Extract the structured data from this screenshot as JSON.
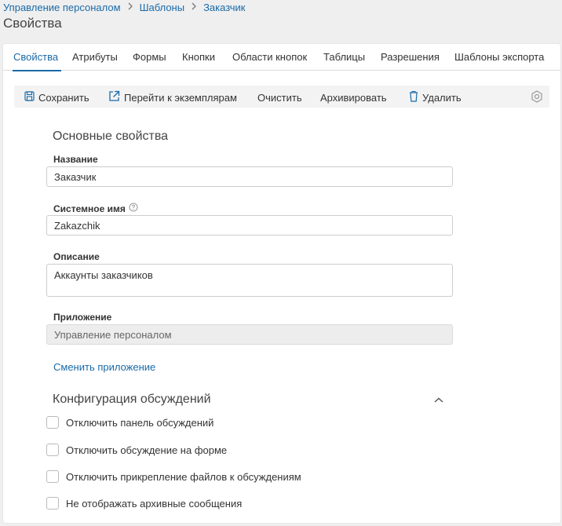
{
  "breadcrumb": {
    "items": [
      "Управление персоналом",
      "Шаблоны",
      "Заказчик"
    ]
  },
  "page": {
    "title": "Свойства"
  },
  "tabs": [
    {
      "label": "Свойства",
      "active": true
    },
    {
      "label": "Атрибуты"
    },
    {
      "label": "Формы"
    },
    {
      "label": "Кнопки"
    },
    {
      "label": "Области кнопок"
    },
    {
      "label": "Таблицы"
    },
    {
      "label": "Разрешения"
    },
    {
      "label": "Шаблоны экспорта"
    }
  ],
  "toolbar": {
    "save": "Сохранить",
    "goto_instances": "Перейти к экземплярам",
    "clear": "Очистить",
    "archive": "Архивировать",
    "delete": "Удалить",
    "settings_icon": "settings-icon"
  },
  "main_props": {
    "title": "Основные свойства",
    "name_label": "Название",
    "name_value": "Заказчик",
    "system_name_label": "Системное имя",
    "system_name_value": "Zakazchik",
    "description_label": "Описание",
    "description_value": "Аккаунты заказчиков",
    "application_label": "Приложение",
    "application_value": "Управление персоналом",
    "change_app_link": "Сменить приложение"
  },
  "discussion": {
    "title": "Конфигурация обсуждений",
    "expanded": true,
    "options": [
      {
        "label": "Отключить панель обсуждений",
        "checked": false
      },
      {
        "label": "Отключить обсуждение на форме",
        "checked": false
      },
      {
        "label": "Отключить прикрепление файлов к обсуждениям",
        "checked": false
      },
      {
        "label": "Не отображать архивные сообщения",
        "checked": false
      }
    ]
  },
  "colors": {
    "accent": "#1a6aa8",
    "background": "#efefef",
    "card": "#ffffff",
    "toolbar": "#f3f3f3"
  }
}
